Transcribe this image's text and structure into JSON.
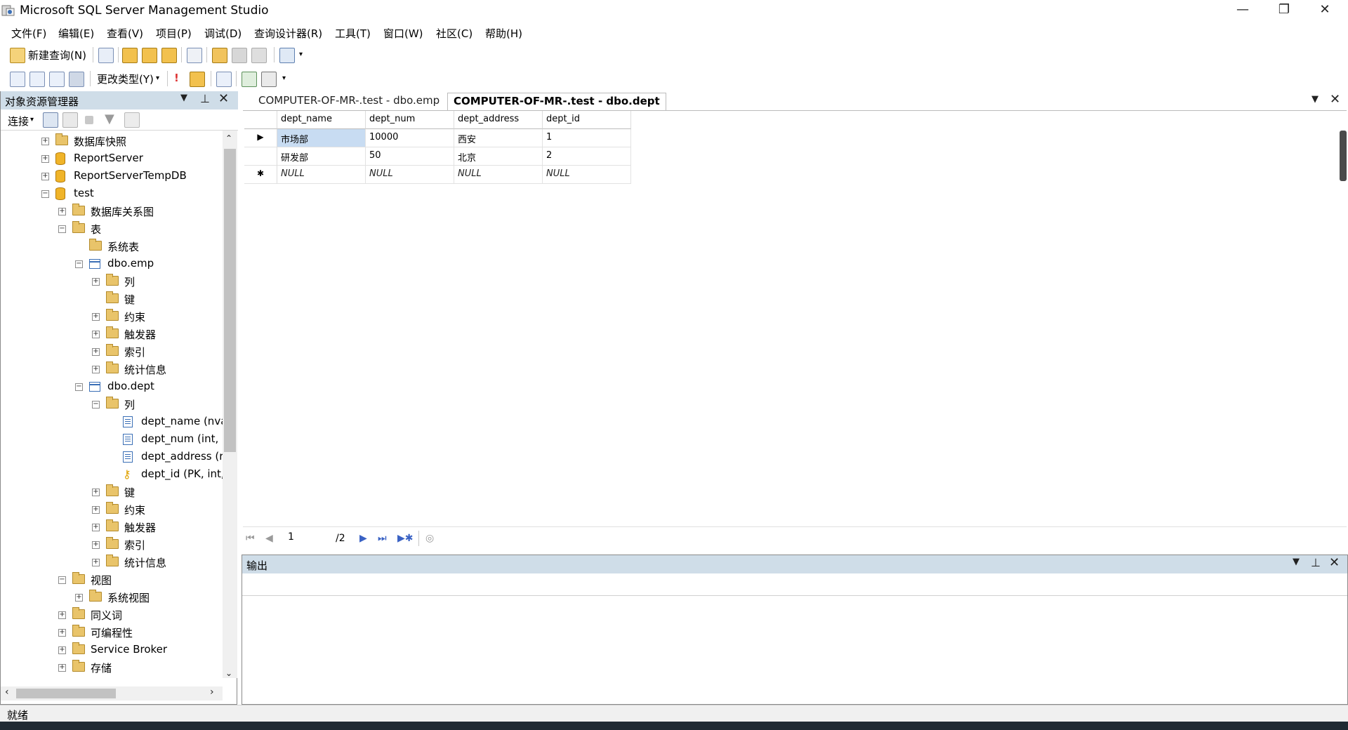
{
  "window": {
    "title": "Microsoft SQL Server Management Studio",
    "controls": {
      "minimize": "—",
      "restore": "❐",
      "close": "✕"
    }
  },
  "menu": [
    "文件(F)",
    "编辑(E)",
    "查看(V)",
    "项目(P)",
    "调试(D)",
    "查询设计器(R)",
    "工具(T)",
    "窗口(W)",
    "社区(C)",
    "帮助(H)"
  ],
  "toolbar1": {
    "new_query": "新建查询(N)"
  },
  "toolbar2": {
    "change_type": "更改类型(Y)"
  },
  "object_explorer": {
    "title": "对象资源管理器",
    "connect": "连接",
    "nodes": [
      {
        "label": "数据库快照",
        "level": 2,
        "icon": "folder",
        "expander": "+"
      },
      {
        "label": "ReportServer",
        "level": 2,
        "icon": "database",
        "expander": "+"
      },
      {
        "label": "ReportServerTempDB",
        "level": 2,
        "icon": "database",
        "expander": "+"
      },
      {
        "label": "test",
        "level": 2,
        "icon": "database",
        "expander": "−"
      },
      {
        "label": "数据库关系图",
        "level": 3,
        "icon": "folder",
        "expander": "+"
      },
      {
        "label": "表",
        "level": 3,
        "icon": "folder",
        "expander": "−"
      },
      {
        "label": "系统表",
        "level": 4,
        "icon": "folder",
        "expander": ""
      },
      {
        "label": "dbo.emp",
        "level": 4,
        "icon": "table",
        "expander": "−"
      },
      {
        "label": "列",
        "level": 5,
        "icon": "folder",
        "expander": "+"
      },
      {
        "label": "键",
        "level": 5,
        "icon": "folder",
        "expander": ""
      },
      {
        "label": "约束",
        "level": 5,
        "icon": "folder",
        "expander": "+"
      },
      {
        "label": "触发器",
        "level": 5,
        "icon": "folder",
        "expander": "+"
      },
      {
        "label": "索引",
        "level": 5,
        "icon": "folder",
        "expander": "+"
      },
      {
        "label": "统计信息",
        "level": 5,
        "icon": "folder",
        "expander": "+"
      },
      {
        "label": "dbo.dept",
        "level": 4,
        "icon": "table",
        "expander": "−"
      },
      {
        "label": "列",
        "level": 5,
        "icon": "folder",
        "expander": "−"
      },
      {
        "label": "dept_name (nva",
        "level": 6,
        "icon": "column",
        "expander": ""
      },
      {
        "label": "dept_num (int, n",
        "level": 6,
        "icon": "column",
        "expander": ""
      },
      {
        "label": "dept_address (r",
        "level": 6,
        "icon": "column",
        "expander": ""
      },
      {
        "label": "dept_id (PK, int,",
        "level": 6,
        "icon": "key",
        "expander": ""
      },
      {
        "label": "键",
        "level": 5,
        "icon": "folder",
        "expander": "+"
      },
      {
        "label": "约束",
        "level": 5,
        "icon": "folder",
        "expander": "+"
      },
      {
        "label": "触发器",
        "level": 5,
        "icon": "folder",
        "expander": "+"
      },
      {
        "label": "索引",
        "level": 5,
        "icon": "folder",
        "expander": "+"
      },
      {
        "label": "统计信息",
        "level": 5,
        "icon": "folder",
        "expander": "+"
      },
      {
        "label": "视图",
        "level": 3,
        "icon": "folder",
        "expander": "−"
      },
      {
        "label": "系统视图",
        "level": 4,
        "icon": "folder",
        "expander": "+"
      },
      {
        "label": "同义词",
        "level": 3,
        "icon": "folder",
        "expander": "+"
      },
      {
        "label": "可编程性",
        "level": 3,
        "icon": "folder",
        "expander": "+"
      },
      {
        "label": "Service Broker",
        "level": 3,
        "icon": "folder",
        "expander": "+"
      },
      {
        "label": "存储",
        "level": 3,
        "icon": "folder",
        "expander": "+"
      }
    ]
  },
  "tabs": [
    {
      "label": "COMPUTER-OF-MR-.test - dbo.emp",
      "active": false
    },
    {
      "label": "COMPUTER-OF-MR-.test - dbo.dept",
      "active": true
    }
  ],
  "grid": {
    "columns": [
      "dept_name",
      "dept_num",
      "dept_address",
      "dept_id"
    ],
    "rows": [
      [
        "市场部",
        "10000",
        "西安",
        "1"
      ],
      [
        "研发部",
        "50",
        "北京",
        "2"
      ],
      [
        "NULL",
        "NULL",
        "NULL",
        "NULL"
      ]
    ],
    "row_markers": [
      "▶",
      "",
      "✱"
    ]
  },
  "navigator": {
    "current": "1",
    "total": "/2"
  },
  "output": {
    "title": "输出"
  },
  "status": {
    "text": "就绪"
  }
}
